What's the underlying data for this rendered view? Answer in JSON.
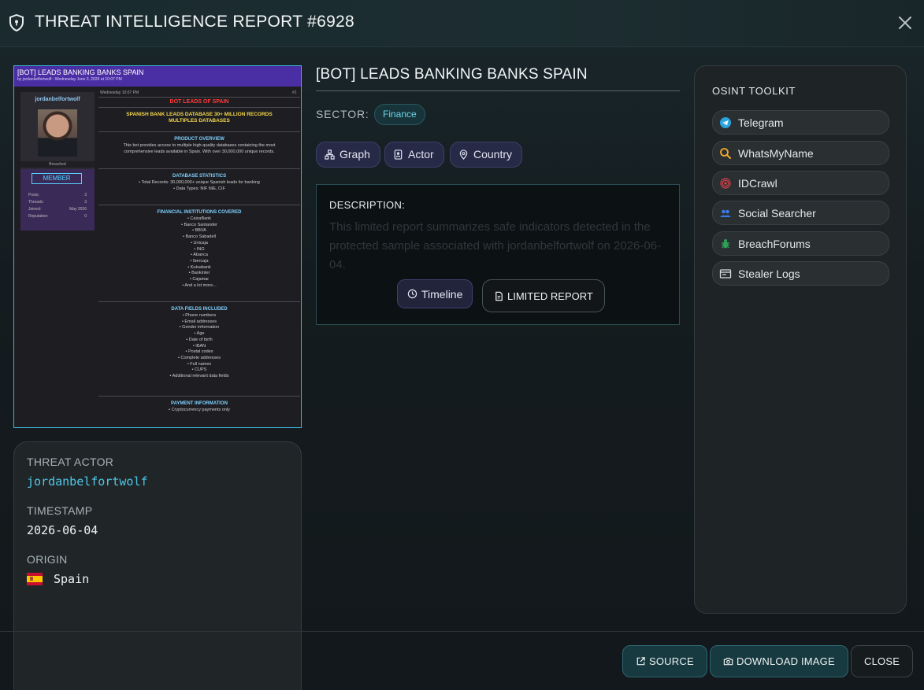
{
  "header": {
    "title": "THREAT INTELLIGENCE REPORT #6928",
    "shield_icon": "shield-icon",
    "close_icon": "close-icon"
  },
  "thumbnail": {
    "bar_title": "[BOT] LEADS BANKING BANKS SPAIN",
    "bar_subtitle": "by jordanbelfortwolf - Wednesday June 3, 2026 at 10:07 PM",
    "username": "jordanbelfortwolf",
    "status": "Breached",
    "rank": "MEMBER",
    "stats": [
      {
        "k": "Posts:",
        "v": "3"
      },
      {
        "k": "Threads:",
        "v": "3"
      },
      {
        "k": "Joined:",
        "v": "May 2026"
      },
      {
        "k": "Reputation:",
        "v": "0"
      }
    ],
    "post_meta": "Wednesday 10:07 PM",
    "post_num": "#1",
    "headline": "BOT LEADS OF SPAIN",
    "sub1": "SPANISH BANK LEADS DATABASE 30+ MILLION RECORDS",
    "sub2": "MULTIPLES DATABASES",
    "sections": [
      {
        "h": "PRODUCT OVERVIEW",
        "lines": [
          "This bot provides access to multiple high-quality databases containing the most",
          "comprehensive leads available in Spain. With over 30,000,000 unique records."
        ]
      },
      {
        "h": "DATABASE STATISTICS",
        "lines": [
          "• Total Records: 30,000,000+ unique Spanish leads for banking",
          "• Data Types: NIF NIE, CIF"
        ]
      },
      {
        "h": "FINANCIAL INSTITUTIONS COVERED",
        "lines": [
          "• CaixaBank",
          "• Banco Santander",
          "• BBVA",
          "• Banco Sabadell",
          "• Unicaja",
          "• ING",
          "• Abanca",
          "• Ibercaja",
          "• Kutxabank",
          "• Bankinter",
          "• Cajamar",
          "• And a lot more..."
        ]
      },
      {
        "h": "DATA FIELDS INCLUDED",
        "lines": [
          "• Phone numbers",
          "• Email addresses",
          "• Gender information",
          "• Age",
          "• Date of birth",
          "• IBAN",
          "• Postal codes",
          "• Complete addresses",
          "• Full names",
          "• CUPS",
          "• Additional relevant data fields"
        ]
      },
      {
        "h": "PAYMENT INFORMATION",
        "lines": [
          "• Cryptocurrency payments only"
        ]
      }
    ]
  },
  "info": {
    "actor_label": "THREAT ACTOR",
    "actor_value": "jordanbelfortwolf",
    "timestamp_label": "TIMESTAMP",
    "timestamp_value": "2026-06-04",
    "origin_label": "ORIGIN",
    "origin_value": "Spain",
    "origin_flag_icon": "spain-flag-icon"
  },
  "report": {
    "title": "[BOT] LEADS BANKING BANKS SPAIN",
    "sector_label": "SECTOR:",
    "sector_value": "Finance",
    "chips": [
      {
        "label": "Graph",
        "icon": "graph-icon"
      },
      {
        "label": "Actor",
        "icon": "actor-icon"
      },
      {
        "label": "Country",
        "icon": "location-pin-icon"
      }
    ],
    "description_label": "DESCRIPTION:",
    "description_text": "This limited report summarizes safe indicators detected in the protected sample associated with jordanbelfortwolf on 2026-06-04.",
    "timeline_label": "Timeline",
    "limited_label": "LIMITED REPORT"
  },
  "osint": {
    "title": "OSINT TOOLKIT",
    "items": [
      {
        "label": "Telegram",
        "icon": "telegram-icon"
      },
      {
        "label": "WhatsMyName",
        "icon": "search-icon"
      },
      {
        "label": "IDCrawl",
        "icon": "fingerprint-icon"
      },
      {
        "label": "Social Searcher",
        "icon": "users-icon"
      },
      {
        "label": "BreachForums",
        "icon": "bug-icon"
      },
      {
        "label": "Stealer Logs",
        "icon": "terminal-icon"
      }
    ]
  },
  "footer": {
    "source_label": "SOURCE",
    "download_label": "DOWNLOAD IMAGE",
    "close_label": "CLOSE"
  },
  "colors": {
    "accent": "#3ab2d6",
    "actor": "#4fc6e8",
    "chip_bg": "#272a46"
  }
}
